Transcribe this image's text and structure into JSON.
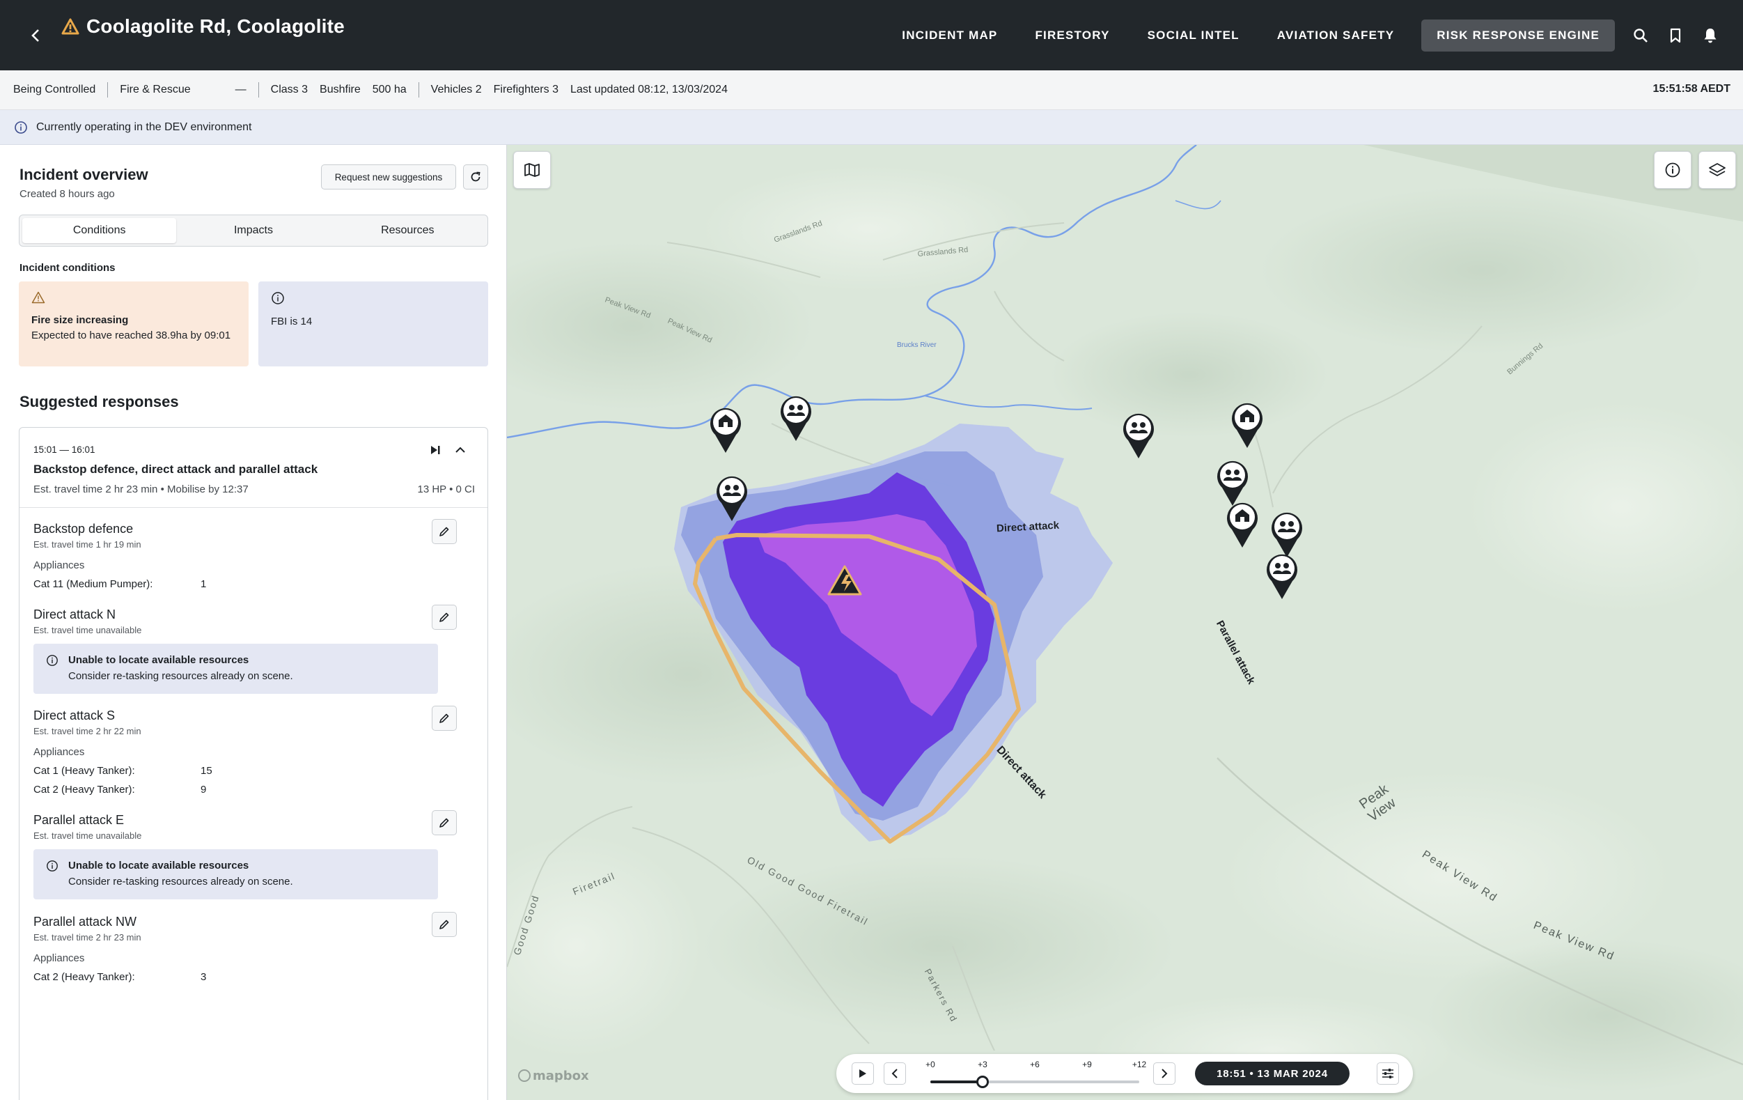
{
  "header": {
    "title": "Coolagolite Rd, Coolagolite",
    "nav": [
      "INCIDENT MAP",
      "FIRESTORY",
      "SOCIAL INTEL",
      "AVIATION SAFETY",
      "RISK RESPONSE ENGINE"
    ]
  },
  "status": {
    "state": "Being Controlled",
    "agency": "Fire & Rescue",
    "dash": "—",
    "class": "Class 3",
    "type": "Bushfire",
    "area": "500 ha",
    "vehicles": "Vehicles 2",
    "firefighters": "Firefighters 3",
    "updated": "Last updated 08:12, 13/03/2024",
    "clock": "15:51:58 AEDT"
  },
  "banner": {
    "text": "Currently operating in the DEV environment"
  },
  "panel": {
    "title": "Incident overview",
    "created": "Created 8 hours ago",
    "request_btn": "Request new suggestions",
    "tabs": [
      "Conditions",
      "Impacts",
      "Resources"
    ],
    "conditions_label": "Incident conditions",
    "cond_warn_title": "Fire size increasing",
    "cond_warn_body": "Expected to have reached 38.9ha by 09:01",
    "cond_info_title": "FBI is 14",
    "suggested_title": "Suggested responses"
  },
  "suggestion": {
    "time": "15:01 — 16:01",
    "name": "Backstop defence, direct attack and parallel attack",
    "meta": "Est. travel time 2 hr 23 min • Mobilise by 12:37",
    "resources": "13 HP • 0 CI",
    "tasks": [
      {
        "name": "Backstop defence",
        "sub": "Est. travel time 1 hr 19 min",
        "appliances_label": "Appliances",
        "rows": [
          {
            "k": "Cat 11 (Medium Pumper):",
            "v": "1"
          }
        ]
      },
      {
        "name": "Direct attack N",
        "sub": "Est. travel time unavailable",
        "notice_title": "Unable to locate available resources",
        "notice_body": "Consider re-tasking resources already on scene."
      },
      {
        "name": "Direct attack S",
        "sub": "Est. travel time 2 hr 22 min",
        "appliances_label": "Appliances",
        "rows": [
          {
            "k": "Cat 1 (Heavy Tanker):",
            "v": "15"
          },
          {
            "k": "Cat 2 (Heavy Tanker):",
            "v": "9"
          }
        ]
      },
      {
        "name": "Parallel attack E",
        "sub": "Est. travel time unavailable",
        "notice_title": "Unable to locate available resources",
        "notice_body": "Consider re-tasking resources already on scene."
      },
      {
        "name": "Parallel attack NW",
        "sub": "Est. travel time 2 hr 23 min",
        "appliances_label": "Appliances",
        "rows": [
          {
            "k": "Cat 2 (Heavy Tanker):",
            "v": "3"
          }
        ]
      }
    ]
  },
  "map": {
    "labels": {
      "direct_attack_n": "Direct attack",
      "direct_attack_s": "Direct attack",
      "parallel_attack": "Parallel attack",
      "peak_view": "Peak View",
      "peak_view_rd_1": "Peak View Rd",
      "peak_view_rd_2": "Peak View Rd",
      "old_good_good": "Old Good Good Firetrail",
      "firetrail": "Firetrail",
      "good_good": "Good Good",
      "parkers_rd": "Parkers Rd"
    },
    "attribution": "mapbox",
    "colors": {
      "fire_core": "#b05ae8",
      "fire_mid": "#6a3ce0",
      "fire_outer": "#8f9ee0",
      "fire_edge": "#b9c4ec",
      "control_line": "#e7b56a",
      "river": "#6f9be6"
    }
  },
  "timeline": {
    "ticks": [
      "+0",
      "+3",
      "+6",
      "+9",
      "+12"
    ],
    "position": 3,
    "max": 12,
    "datetime": "18:51 • 13 MAR 2024"
  }
}
